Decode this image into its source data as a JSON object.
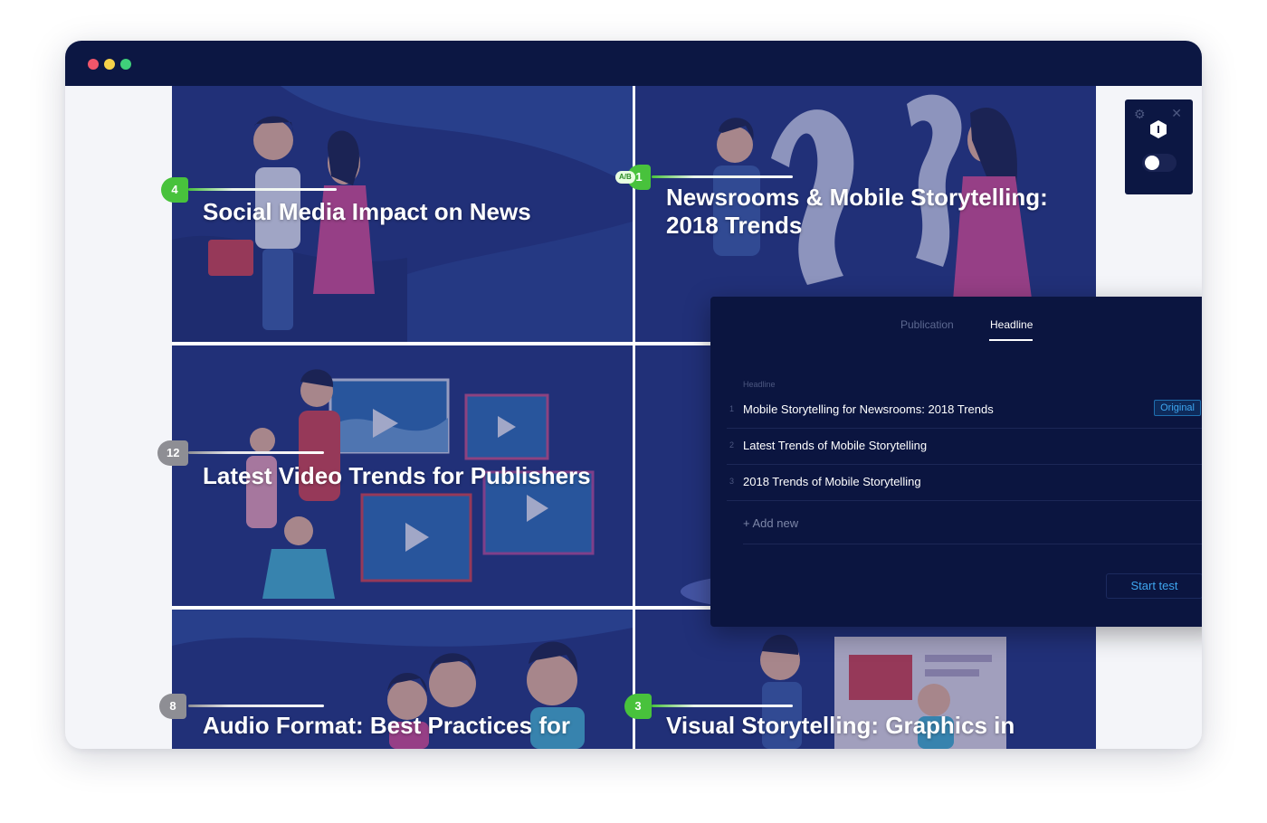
{
  "window": {
    "controls": [
      "close",
      "minimize",
      "maximize"
    ]
  },
  "tiles": [
    {
      "title": "Social Media Impact on News",
      "badge": "4",
      "badge_color": "#48c23c"
    },
    {
      "title": "Newsrooms & Mobile Storytelling: 2018 Trends",
      "badge": "1",
      "ab_label": "A/B",
      "badge_color": "#48c23c"
    },
    {
      "title": "Latest Video Trends for Publishers",
      "badge": "12",
      "badge_color": "#8e8e94"
    },
    {
      "title": "Audio Format: Best Practices for",
      "badge": "8",
      "badge_color": "#8e8e94"
    },
    {
      "title": "Visual Storytelling: Graphics in",
      "badge": "3",
      "badge_color": "#48c23c"
    }
  ],
  "panel": {
    "tabs": [
      "Publication",
      "Headline"
    ],
    "active_tab": "Headline",
    "field_label": "Headline",
    "headlines": [
      {
        "num": "1",
        "text": "Mobile Storytelling for Newsrooms: 2018 Trends",
        "tag": "Original"
      },
      {
        "num": "2",
        "text": "Latest Trends of Mobile Storytelling"
      },
      {
        "num": "3",
        "text": "2018 Trends of Mobile Storytelling"
      }
    ],
    "add_new": "+ Add new",
    "start_button": "Start test"
  },
  "widget": {
    "settings_icon": "gear-icon",
    "close_icon": "close-icon",
    "logo_icon": "hexagon-logo-icon",
    "toggle_on": false
  },
  "colors": {
    "titlebar": "#0c1743",
    "panel": "#0b1540",
    "accent_green": "#48c23c",
    "accent_blue": "#3ea6f0"
  }
}
